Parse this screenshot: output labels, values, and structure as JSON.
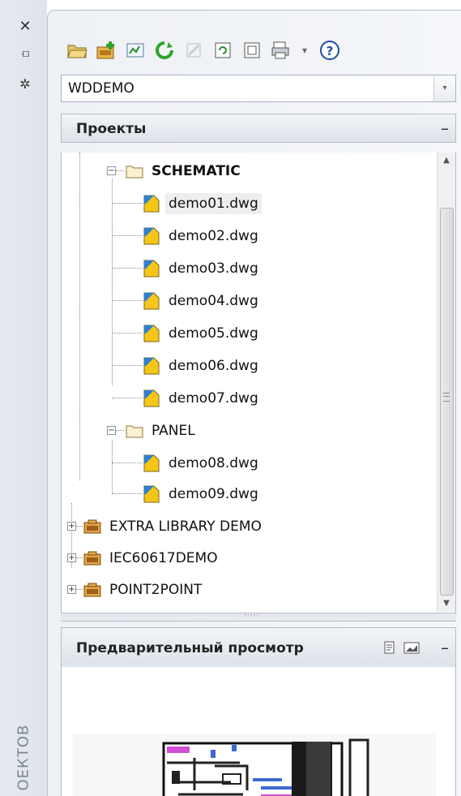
{
  "strip": {
    "close_icon": "close-icon",
    "autohide_icon": "autohide-icon",
    "properties_icon": "properties-icon",
    "vertical_title": "ОЕКТОВ"
  },
  "toolbar": {
    "icons": [
      "open-project-icon",
      "new-project-icon",
      "new-drawing-icon",
      "refresh-icon",
      "migrate-icon",
      "update-icon",
      "title-block-icon",
      "plot-icon",
      "help-icon"
    ],
    "dropdown_symbol": "▾",
    "help_symbol": "?"
  },
  "combo": {
    "value": "WDDEMO",
    "arrow": "▾"
  },
  "projects_panel": {
    "title": "Проекты",
    "minimize": "–"
  },
  "tree": {
    "folders": [
      {
        "label": "SCHEMATIC",
        "expanded_symbol": "−",
        "items": [
          "demo01.dwg",
          "demo02.dwg",
          "demo03.dwg",
          "demo04.dwg",
          "demo05.dwg",
          "demo06.dwg",
          "demo07.dwg"
        ]
      },
      {
        "label": "PANEL",
        "expanded_symbol": "−",
        "items": [
          "demo08.dwg",
          "demo09.dwg"
        ]
      }
    ],
    "projects": [
      {
        "label": "EXTRA LIBRARY DEMO",
        "collapsed_symbol": "+"
      },
      {
        "label": "IEC60617DEMO",
        "collapsed_symbol": "+"
      },
      {
        "label": "POINT2POINT",
        "collapsed_symbol": "+"
      }
    ],
    "selected": "demo01.dwg"
  },
  "scrollbar": {
    "up": "▲",
    "down": "▼"
  },
  "splitter": {
    "grip": "·····"
  },
  "preview_panel": {
    "title": "Предварительный просмотр",
    "minimize": "–"
  },
  "colors": {
    "accent_yellow": "#f5c518",
    "folder": "#f0d27a",
    "selection": "#eeeeee"
  }
}
